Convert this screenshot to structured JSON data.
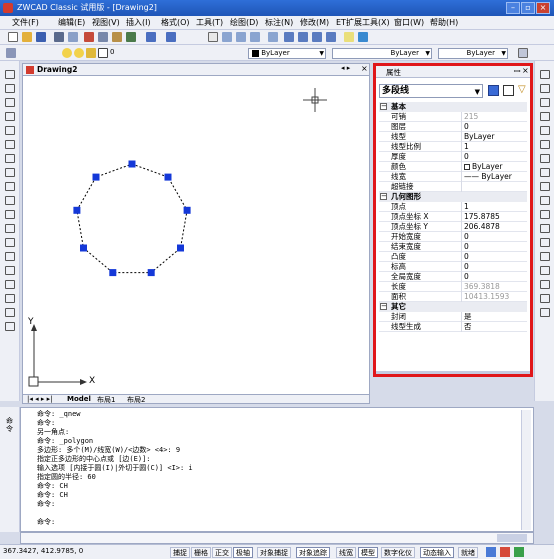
{
  "window": {
    "title": "ZWCAD Classic 试用版 - [Drawing2]",
    "controls": [
      "minimize",
      "restore",
      "close"
    ]
  },
  "menu": [
    "文件(F)",
    "编辑(E)",
    "视图(V)",
    "插入(I)",
    "格式(O)",
    "工具(T)",
    "绘图(D)",
    "标注(N)",
    "修改(M)",
    "ET扩展工具(X)",
    "窗口(W)",
    "帮助(H)"
  ],
  "toolbar2": {
    "layer_value": "0",
    "color_value": "ByLayer",
    "linetype_value": "ByLayer",
    "lineweight_value": "ByLayer"
  },
  "drawing": {
    "tab_title": "Drawing2",
    "axis_y": "Y",
    "axis_x": "X",
    "layout_tabs": [
      "Model",
      "布局1",
      "布局2"
    ]
  },
  "properties": {
    "title": "属性",
    "selected": "多段线",
    "categories": [
      {
        "label": "基本",
        "rows": [
          {
            "key": "可销",
            "value": "215",
            "grey": true
          },
          {
            "key": "图层",
            "value": "0"
          },
          {
            "key": "线型",
            "value": "ByLayer"
          },
          {
            "key": "线型比例",
            "value": "1"
          },
          {
            "key": "厚度",
            "value": "0"
          },
          {
            "key": "颜色",
            "value": "ByLayer"
          },
          {
            "key": "线宽",
            "value": "—— ByLayer"
          },
          {
            "key": "超链接",
            "value": ""
          }
        ]
      },
      {
        "label": "几何图形",
        "rows": [
          {
            "key": "顶点",
            "value": "1"
          },
          {
            "key": "顶点坐标 X",
            "value": "175.8785"
          },
          {
            "key": "顶点坐标 Y",
            "value": "206.4878"
          },
          {
            "key": "开始宽度",
            "value": "0"
          },
          {
            "key": "结束宽度",
            "value": "0"
          },
          {
            "key": "凸度",
            "value": "0"
          },
          {
            "key": "标高",
            "value": "0"
          },
          {
            "key": "全局宽度",
            "value": "0"
          },
          {
            "key": "长度",
            "value": "369.3818",
            "grey": true
          },
          {
            "key": "面积",
            "value": "10413.1593",
            "grey": true
          }
        ]
      },
      {
        "label": "其它",
        "rows": [
          {
            "key": "封闭",
            "value": "是"
          },
          {
            "key": "线型生成",
            "value": "否"
          }
        ]
      }
    ]
  },
  "command": {
    "side_label": "命令",
    "history": [
      "命令: _qnew",
      "命令:",
      "另一角点:",
      "命令: _polygon",
      "多边形:  多个(M)/线宽(W)/<边数> <4>: 9",
      "指定正多边形的中心点或 [边(E)]:",
      "输入选项 [内接于圆(I)|外切于圆(C)] <I>: i",
      "指定圆的半径: 60",
      "命令: CH",
      "命令: CH",
      "命令:",
      "",
      "命令:"
    ]
  },
  "status": {
    "coords": "367.3427,  412.9785,  0",
    "toggles": [
      "捕捉",
      "栅格",
      "正交",
      "极轴",
      "对象捕捉",
      "对象追踪",
      "线宽",
      "模型",
      "数字化仪",
      "动态输入",
      "就绪"
    ]
  },
  "colors": {
    "highlight_border": "#e0161a",
    "grip": "#1438d8",
    "title_bar": "#2f6fd8"
  }
}
